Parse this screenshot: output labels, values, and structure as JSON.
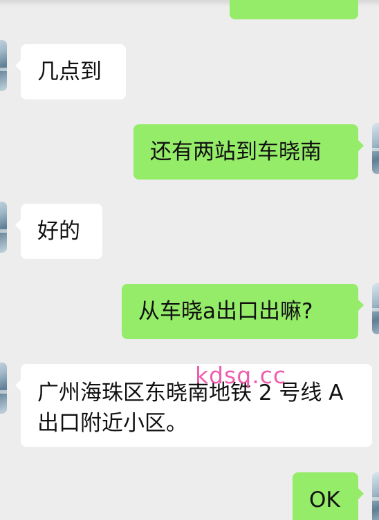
{
  "messages": [
    {
      "id": "m1",
      "side": "in",
      "text": "几点到"
    },
    {
      "id": "m2",
      "side": "out",
      "text": "还有两站到车晓南"
    },
    {
      "id": "m3",
      "side": "in",
      "text": "好的"
    },
    {
      "id": "m4",
      "side": "out",
      "text": "从车晓a出口出嘛?"
    },
    {
      "id": "m5",
      "side": "in",
      "text": "广州海珠区东晓南地铁 2 号线 A 出口附近小区。"
    },
    {
      "id": "m6",
      "side": "out",
      "text": "OK"
    }
  ],
  "watermark": "kdsq.cc"
}
